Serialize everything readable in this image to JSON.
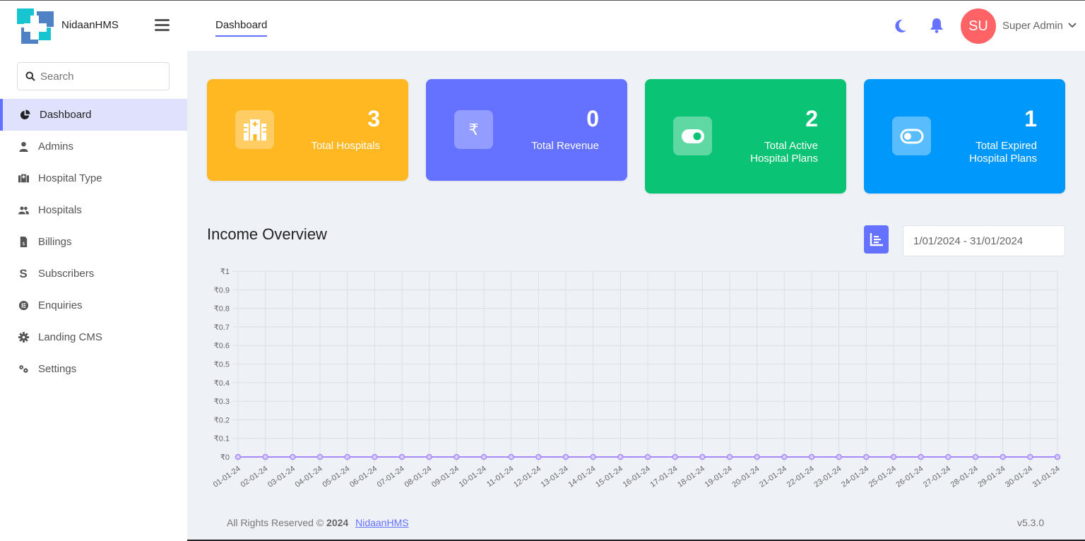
{
  "app": {
    "name": "NidaanHMS"
  },
  "header": {
    "tab": "Dashboard",
    "user": {
      "initials": "SU",
      "name": "Super Admin",
      "avatar_color": "#ff6366"
    },
    "icons": [
      "moon-icon",
      "bell-icon"
    ]
  },
  "sidebar": {
    "search_placeholder": "Search",
    "items": [
      {
        "label": "Dashboard",
        "icon": "pie-chart-icon",
        "active": true
      },
      {
        "label": "Admins",
        "icon": "user-icon"
      },
      {
        "label": "Hospital Type",
        "icon": "hospital-type-icon"
      },
      {
        "label": "Hospitals",
        "icon": "users-icon"
      },
      {
        "label": "Billings",
        "icon": "invoice-icon"
      },
      {
        "label": "Subscribers",
        "icon": "s-icon"
      },
      {
        "label": "Enquiries",
        "icon": "enquiry-icon"
      },
      {
        "label": "Landing CMS",
        "icon": "gear-icon"
      },
      {
        "label": "Settings",
        "icon": "gears-icon"
      }
    ]
  },
  "cards": [
    {
      "value": "3",
      "label": "Total Hospitals",
      "color": "#ffb822",
      "icon": "hospital-icon"
    },
    {
      "value": "0",
      "label": "Total Revenue",
      "color": "#6571ff",
      "icon": "rupee-icon"
    },
    {
      "value": "2",
      "label": "Total Active Hospital Plans",
      "label_line1": "Total Active",
      "label_line2": "Hospital Plans",
      "color": "#0bc374",
      "icon": "toggle-on-icon"
    },
    {
      "value": "1",
      "label": "Total Expired Hospital Plans",
      "label_line1": "Total Expired",
      "label_line2": "Hospital Plans",
      "color": "#0099fb",
      "icon": "toggle-off-icon"
    }
  ],
  "income": {
    "title": "Income Overview",
    "date_range": "1/01/2024 - 31/01/2024"
  },
  "chart_data": {
    "type": "line",
    "title": "Income Overview",
    "xlabel": "",
    "ylabel": "",
    "x": [
      "01-01-24",
      "02-01-24",
      "03-01-24",
      "04-01-24",
      "05-01-24",
      "06-01-24",
      "07-01-24",
      "08-01-24",
      "09-01-24",
      "10-01-24",
      "11-01-24",
      "12-01-24",
      "13-01-24",
      "14-01-24",
      "15-01-24",
      "16-01-24",
      "17-01-24",
      "18-01-24",
      "19-01-24",
      "20-01-24",
      "21-01-24",
      "22-01-24",
      "23-01-24",
      "24-01-24",
      "25-01-24",
      "26-01-24",
      "27-01-24",
      "28-01-24",
      "29-01-24",
      "30-01-24",
      "31-01-24"
    ],
    "series": [
      {
        "name": "Income",
        "values": [
          0,
          0,
          0,
          0,
          0,
          0,
          0,
          0,
          0,
          0,
          0,
          0,
          0,
          0,
          0,
          0,
          0,
          0,
          0,
          0,
          0,
          0,
          0,
          0,
          0,
          0,
          0,
          0,
          0,
          0,
          0
        ],
        "color": "#a78bfa"
      }
    ],
    "ylim": [
      0,
      1
    ],
    "yticks": [
      "₹1",
      "₹0.9",
      "₹0.8",
      "₹0.7",
      "₹0.6",
      "₹0.5",
      "₹0.4",
      "₹0.3",
      "₹0.2",
      "₹0.1",
      "₹0"
    ],
    "ytick_values": [
      1,
      0.9,
      0.8,
      0.7,
      0.6,
      0.5,
      0.4,
      0.3,
      0.2,
      0.1,
      0
    ],
    "grid": true,
    "legend": "none"
  },
  "footer": {
    "text": "All Rights Reserved ©",
    "year": "2024",
    "link": "NidaanHMS",
    "version": "v5.3.0"
  }
}
